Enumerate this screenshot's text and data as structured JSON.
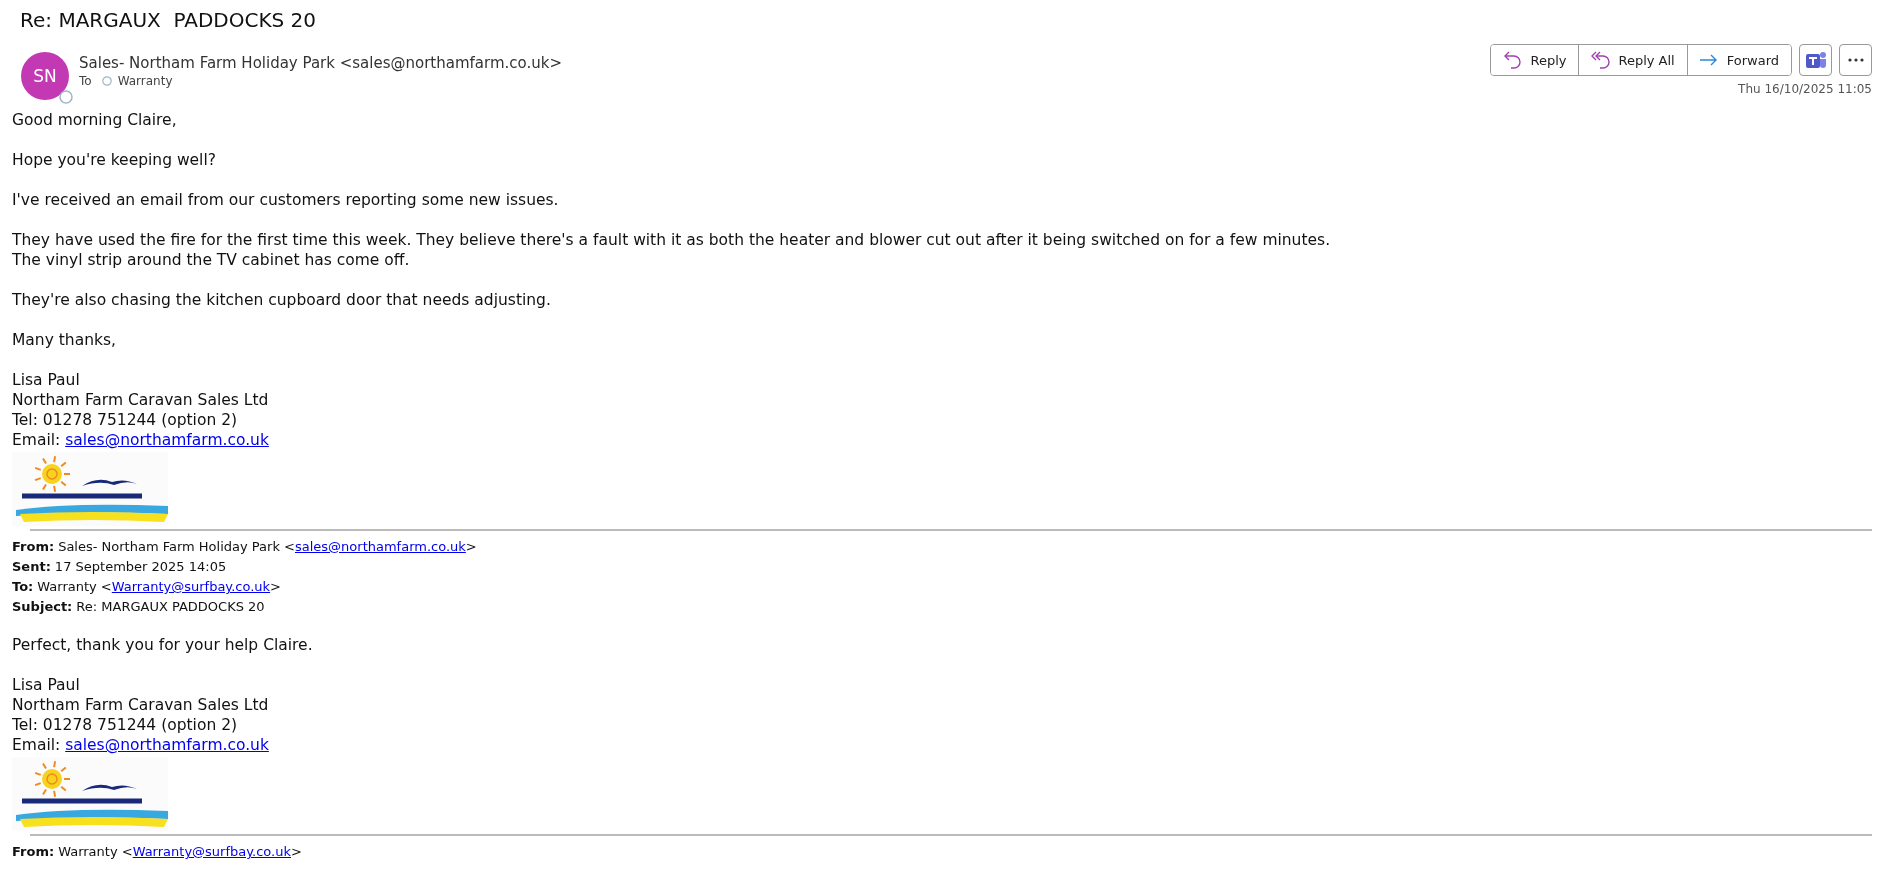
{
  "message": {
    "subject": "Re: MARGAUX  PADDOCKS 20",
    "sender": {
      "initials": "SN",
      "name": "Sales- Northam Farm Holiday Park <sales@northamfarm.co.uk>"
    },
    "to_label": "To",
    "recipients": [
      "Warranty"
    ],
    "actions": [
      {
        "kind": "reply",
        "label": "Reply"
      },
      {
        "kind": "reply_all",
        "label": "Reply All"
      },
      {
        "kind": "forward",
        "label": "Forward"
      }
    ],
    "date": "Thu 16/10/2025 11:05"
  },
  "body": [
    {
      "kind": "paragraph",
      "lines": [
        {
          "text": "Good morning Claire,"
        }
      ]
    },
    {
      "kind": "paragraph",
      "lines": [
        {
          "text": "Hope you're keeping well?"
        }
      ]
    },
    {
      "kind": "paragraph",
      "lines": [
        {
          "text": "I've received an email from our customers reporting some new issues."
        }
      ]
    },
    {
      "kind": "paragraph",
      "lines": [
        {
          "text": "They have used the fire for the first time this week. They believe there's a fault with it as both the heater and blower cut out after it being switched on for a few minutes."
        },
        {
          "text": "The vinyl strip around the TV cabinet has come off."
        }
      ]
    },
    {
      "kind": "paragraph",
      "lines": [
        {
          "text": "They're also chasing the kitchen cupboard door that needs adjusting."
        }
      ]
    },
    {
      "kind": "paragraph",
      "lines": [
        {
          "text": "Many thanks,"
        }
      ]
    },
    {
      "kind": "signature",
      "lines": [
        {
          "text": "Lisa Paul"
        },
        {
          "text": "Northam Farm Caravan Sales Ltd"
        },
        {
          "text": "Tel: 01278 751244 (option 2)"
        },
        {
          "text": "Email: ",
          "link": "sales@northamfarm.co.uk"
        }
      ]
    },
    {
      "kind": "picture"
    },
    {
      "kind": "quoted_header",
      "fields": [
        {
          "label": "From:",
          "text": "Sales- Northam Farm Holiday Park <",
          "link": "sales@northamfarm.co.uk",
          "after": ">"
        },
        {
          "label": "Sent:",
          "text": "17 September 2025 14:05"
        },
        {
          "label": "To:",
          "text": "Warranty <",
          "link": "Warranty@surfbay.co.uk",
          "after": ">"
        },
        {
          "label": "Subject:",
          "text": "Re: MARGAUX PADDOCKS 20"
        }
      ]
    },
    {
      "kind": "paragraph",
      "lines": [
        {
          "text": "Perfect, thank you for your help Claire."
        }
      ]
    },
    {
      "kind": "signature",
      "lines": [
        {
          "text": "Lisa Paul"
        },
        {
          "text": "Northam Farm Caravan Sales Ltd"
        },
        {
          "text": "Tel: 01278 751244 (option 2)"
        },
        {
          "text": "Email: ",
          "link": "sales@northamfarm.co.uk"
        }
      ]
    },
    {
      "kind": "picture"
    },
    {
      "kind": "quoted_header",
      "fields": [
        {
          "label": "From:",
          "text": "Warranty <",
          "link": "Warranty@surfbay.co.uk",
          "after": ">"
        }
      ]
    }
  ]
}
